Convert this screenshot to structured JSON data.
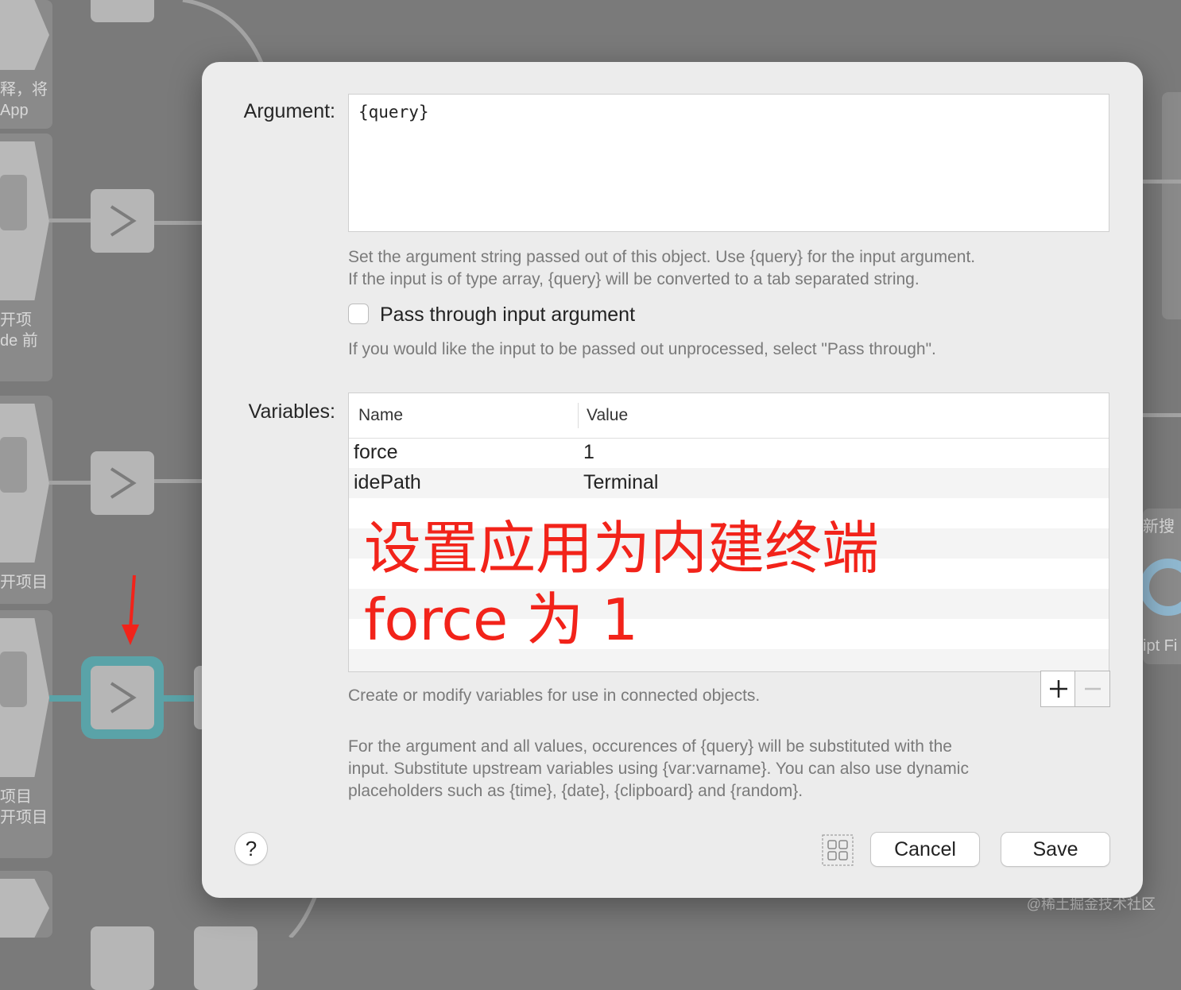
{
  "background": {
    "left_labels": [
      {
        "text": "释，将\nApp"
      },
      {
        "text": "开项\nde 前"
      },
      {
        "text": "开项目"
      },
      {
        "text": "项目\n开项目"
      }
    ],
    "right_labels": {
      "top": "新搜",
      "bottom": "ipt Fi"
    },
    "watermark": "@稀土掘金技术社区"
  },
  "dialog": {
    "argument_label": "Argument:",
    "argument_value": "{query}",
    "argument_hint_1": "Set the argument string passed out of this object. Use {query} for the input argument.",
    "argument_hint_2": "If the input is of type array, {query} will be converted to a tab separated string.",
    "pass_through_label": "Pass through input argument",
    "pass_through_checked": false,
    "pass_through_hint": "If you would like the input to be passed out unprocessed, select \"Pass through\".",
    "variables_label": "Variables:",
    "table": {
      "columns": [
        "Name",
        "Value"
      ],
      "rows": [
        {
          "name": "force",
          "value": "1"
        },
        {
          "name": "idePath",
          "value": "Terminal"
        }
      ]
    },
    "annotation_line_1": "设置应用为内建终端",
    "annotation_line_2": "force 为 1",
    "variables_hint": "Create or modify variables for use in connected objects.",
    "footer_hint_1": "For the argument and all values, occurences of {query} will be substituted with the",
    "footer_hint_2": "input. Substitute upstream variables using {var:varname}. You can also use dynamic",
    "footer_hint_3": "placeholders such as {time}, {date}, {clipboard} and {random}.",
    "help_label": "?",
    "cancel_label": "Cancel",
    "save_label": "Save"
  },
  "icons": {
    "node": "chevron-right-icon",
    "add": "plus-icon",
    "remove": "minus-icon",
    "grid": "grid-icon",
    "arrow": "red-arrow-icon"
  },
  "colors": {
    "annotation": "#f2231a",
    "selected_node": "#5aa3a8"
  }
}
